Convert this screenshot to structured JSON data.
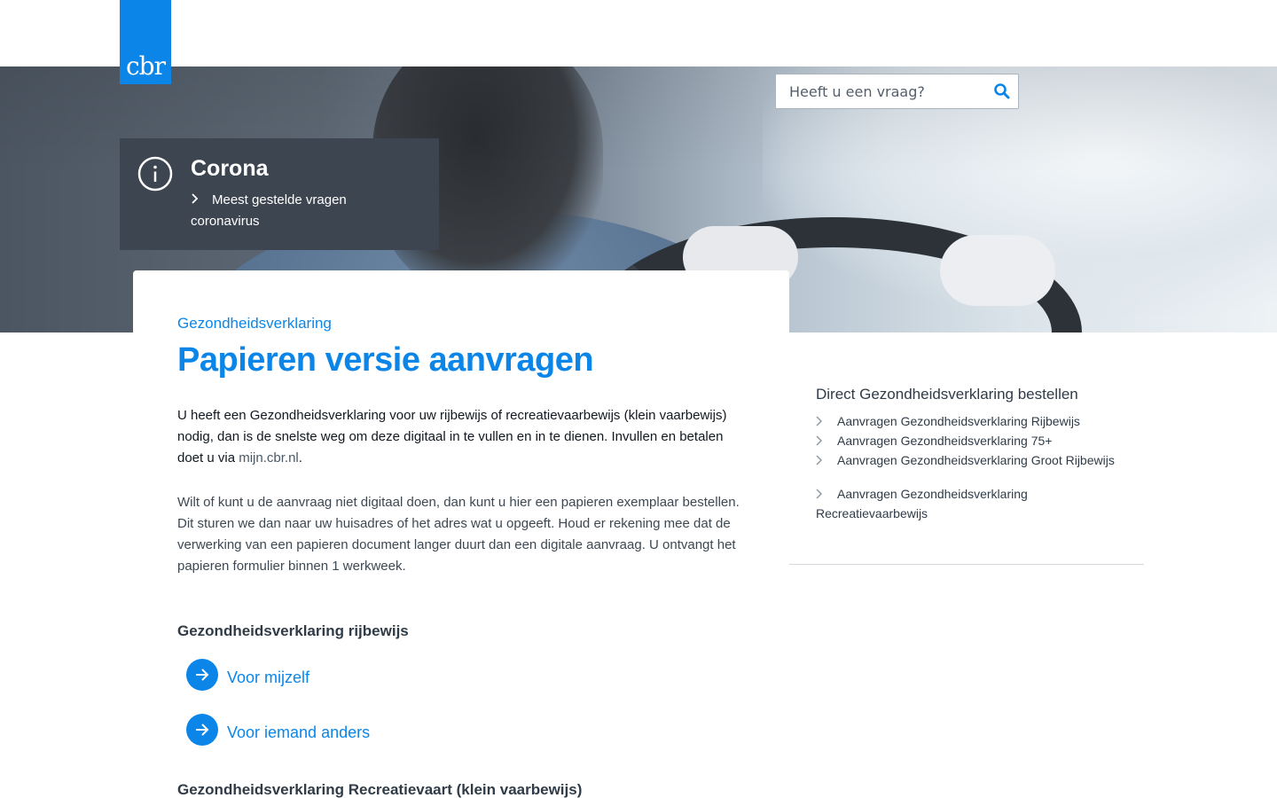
{
  "brand": {
    "logo_text": "cbr",
    "color": "#0b86e8"
  },
  "search": {
    "placeholder": "Heeft u een vraag?",
    "icon": "search-icon"
  },
  "corona": {
    "icon": "info-icon",
    "title": "Corona",
    "link": "Meest gestelde vragen coronavirus"
  },
  "main": {
    "breadcrumb": "Gezondheidsverklaring",
    "title": "Papieren versie aanvragen",
    "intro_text": "U heeft een Gezondheidsverklaring voor uw rijbewijs of recreatievaarbewijs (klein vaarbewijs) nodig, dan is de snelste weg om deze digitaal in te vullen en in te dienen. Invullen en betalen doet u via ",
    "intro_link": "mijn.cbr.nl",
    "intro_end": ".",
    "paragraph": "Wilt of kunt u de aanvraag niet digitaal doen, dan kunt u hier een papieren exemplaar bestellen. Dit sturen we dan naar uw huisadres of het adres wat u opgeeft. Houd er rekening mee dat de verwerking van een papieren document langer duurt dan een digitale aanvraag. U ontvangt het papieren formulier binnen 1 werkweek.",
    "section1_title": "Gezondheidsverklaring rijbewijs",
    "cta_self": "Voor mijzelf",
    "cta_other": "Voor iemand anders",
    "section2_title": "Gezondheidsverklaring Recreatievaart (klein vaarbewijs)"
  },
  "sidebar": {
    "title": "Direct Gezondheidsverklaring bestellen",
    "items": [
      "Aanvragen Gezondheidsverklaring Rijbewijs",
      "Aanvragen Gezondheidsverklaring 75+",
      "Aanvragen Gezondheidsverklaring Groot Rijbewijs",
      "Aanvragen Gezondheidsverklaring Recreatievaarbewijs"
    ]
  }
}
